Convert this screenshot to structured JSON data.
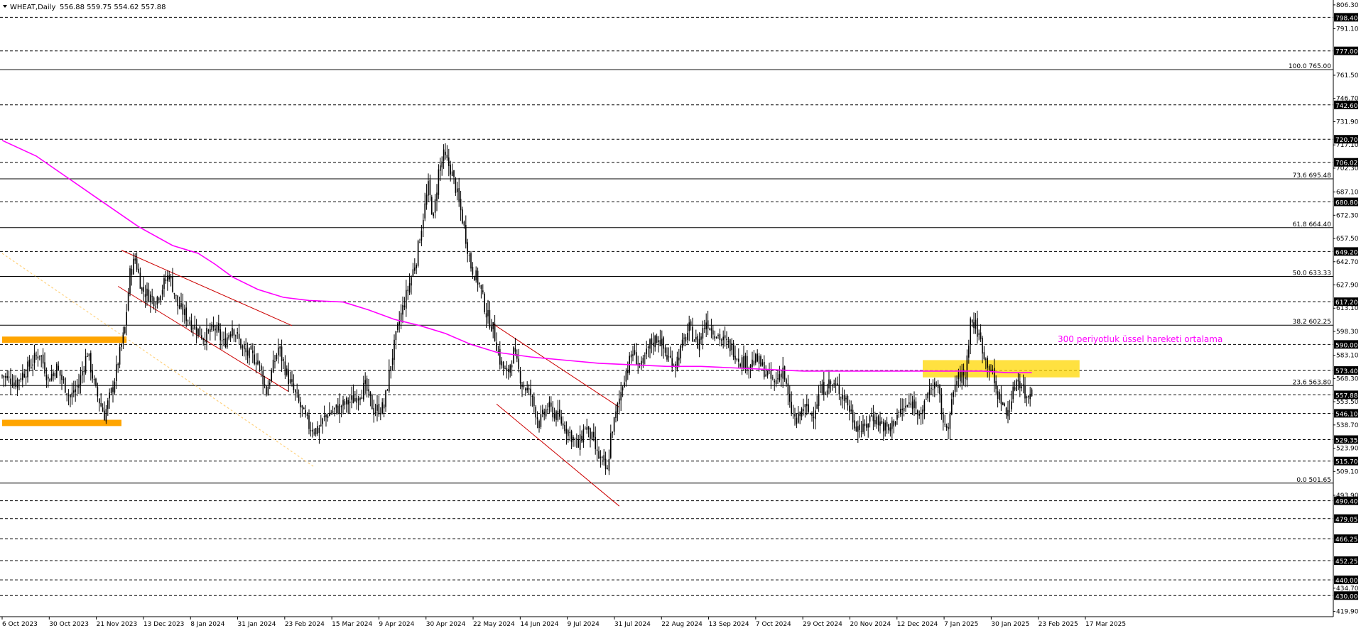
{
  "symbol_header": {
    "symbol": "WHEAT,Daily",
    "ohlc": "556.88 559.75 554.62 557.88"
  },
  "annotation_text": "300 periyotluk üssel hareketi ortalama",
  "colors": {
    "background": "#ffffff",
    "candle": "#000000",
    "ema": "#ff00ff",
    "zone": "#ffa500",
    "zone_highlight": "#ffd700",
    "channel": "#cc0000",
    "dotted_trend": "#ffd27f",
    "label_bg": "#000000",
    "label_text": "#ffffff",
    "annotation": "#ff00ff"
  },
  "chart_data": {
    "type": "candlestick",
    "symbol": "WHEAT",
    "timeframe": "Daily",
    "y_range": [
      417,
      806.25
    ],
    "price_axis_ticks": [
      "806.30",
      "791.10",
      "761.50",
      "746.70",
      "731.90",
      "717.10",
      "702.30",
      "687.10",
      "672.30",
      "657.50",
      "642.70",
      "627.90",
      "613.10",
      "598.30",
      "583.10",
      "568.30",
      "553.50",
      "538.70",
      "523.90",
      "509.10",
      "493.90",
      "434.70",
      "419.90"
    ],
    "date_axis_ticks": [
      "6 Oct 2023",
      "30 Oct 2023",
      "21 Nov 2023",
      "13 Dec 2023",
      "8 Jan 2024",
      "31 Jan 2024",
      "23 Feb 2024",
      "15 Mar 2024",
      "9 Apr 2024",
      "30 Apr 2024",
      "22 May 2024",
      "14 Jun 2024",
      "9 Jul 2024",
      "31 Jul 2024",
      "22 Aug 2024",
      "13 Sep 2024",
      "7 Oct 2024",
      "29 Oct 2024",
      "20 Nov 2024",
      "12 Dec 2024",
      "7 Jan 2025",
      "30 Jan 2025",
      "23 Feb 2025",
      "17 Mar 2025"
    ],
    "horizontal_levels": [
      "798.40",
      "777.00",
      "742.60",
      "720.70",
      "706.02",
      "680.80",
      "649.20",
      "617.20",
      "590.00",
      "573.40",
      "557.88",
      "546.10",
      "529.35",
      "515.70",
      "490.40",
      "479.05",
      "466.25",
      "452.25",
      "440.00",
      "430.00"
    ],
    "fibonacci_levels": [
      {
        "label": "100.0 765.00",
        "price": 765.0
      },
      {
        "label": "73.6 695.48",
        "price": 695.48
      },
      {
        "label": "61.8 664.40",
        "price": 664.4
      },
      {
        "label": "50.0 633.33",
        "price": 633.33
      },
      {
        "label": "38.2 602.25",
        "price": 602.25
      },
      {
        "label": "23.6 563.80",
        "price": 563.8
      },
      {
        "label": "0.0 501.65",
        "price": 501.65
      }
    ],
    "close_path": [
      [
        0,
        570
      ],
      [
        8,
        566
      ],
      [
        15,
        575
      ],
      [
        22,
        585
      ],
      [
        27,
        568
      ],
      [
        32,
        575
      ],
      [
        40,
        556
      ],
      [
        45,
        565
      ],
      [
        50,
        585
      ],
      [
        55,
        560
      ],
      [
        60,
        545
      ],
      [
        65,
        563
      ],
      [
        72,
        600
      ],
      [
        75,
        635
      ],
      [
        78,
        645
      ],
      [
        82,
        625
      ],
      [
        90,
        618
      ],
      [
        98,
        635
      ],
      [
        103,
        615
      ],
      [
        110,
        605
      ],
      [
        118,
        595
      ],
      [
        125,
        600
      ],
      [
        130,
        590
      ],
      [
        135,
        602
      ],
      [
        142,
        585
      ],
      [
        150,
        580
      ],
      [
        155,
        560
      ],
      [
        162,
        588
      ],
      [
        168,
        568
      ],
      [
        175,
        550
      ],
      [
        180,
        538
      ],
      [
        185,
        535
      ],
      [
        190,
        545
      ],
      [
        198,
        550
      ],
      [
        206,
        555
      ],
      [
        213,
        563
      ],
      [
        218,
        548
      ],
      [
        224,
        550
      ],
      [
        228,
        578
      ],
      [
        233,
        605
      ],
      [
        238,
        625
      ],
      [
        243,
        645
      ],
      [
        247,
        672
      ],
      [
        250,
        690
      ],
      [
        253,
        670
      ],
      [
        256,
        700
      ],
      [
        259,
        710
      ],
      [
        263,
        702
      ],
      [
        266,
        690
      ],
      [
        270,
        670
      ],
      [
        275,
        640
      ],
      [
        280,
        628
      ],
      [
        284,
        610
      ],
      [
        288,
        600
      ],
      [
        292,
        580
      ],
      [
        296,
        570
      ],
      [
        300,
        585
      ],
      [
        305,
        565
      ],
      [
        310,
        558
      ],
      [
        315,
        540
      ],
      [
        320,
        550
      ],
      [
        325,
        545
      ],
      [
        332,
        535
      ],
      [
        338,
        525
      ],
      [
        342,
        538
      ],
      [
        346,
        530
      ],
      [
        349,
        520
      ],
      [
        352,
        515
      ],
      [
        355,
        508
      ],
      [
        357,
        532
      ],
      [
        360,
        545
      ],
      [
        365,
        570
      ],
      [
        370,
        585
      ],
      [
        375,
        575
      ],
      [
        380,
        590
      ],
      [
        385,
        595
      ],
      [
        390,
        582
      ],
      [
        395,
        578
      ],
      [
        400,
        592
      ],
      [
        403,
        600
      ],
      [
        408,
        590
      ],
      [
        413,
        605
      ],
      [
        418,
        598
      ],
      [
        423,
        592
      ],
      [
        428,
        588
      ],
      [
        433,
        580
      ],
      [
        438,
        578
      ],
      [
        443,
        580
      ],
      [
        448,
        572
      ],
      [
        453,
        565
      ],
      [
        458,
        575
      ],
      [
        462,
        550
      ],
      [
        466,
        540
      ],
      [
        470,
        550
      ],
      [
        475,
        545
      ],
      [
        480,
        560
      ],
      [
        485,
        565
      ],
      [
        490,
        562
      ],
      [
        495,
        555
      ],
      [
        500,
        540
      ],
      [
        505,
        535
      ],
      [
        510,
        545
      ],
      [
        515,
        540
      ],
      [
        520,
        535
      ],
      [
        525,
        545
      ],
      [
        530,
        550
      ],
      [
        535,
        553
      ],
      [
        540,
        545
      ],
      [
        543,
        560
      ],
      [
        547,
        565
      ],
      [
        550,
        555
      ],
      [
        553,
        535
      ],
      [
        556,
        545
      ],
      [
        559,
        565
      ],
      [
        562,
        570
      ],
      [
        565,
        570
      ],
      [
        568,
        605
      ],
      [
        571,
        602
      ],
      [
        574,
        592
      ],
      [
        577,
        580
      ],
      [
        580,
        575
      ],
      [
        583,
        560
      ],
      [
        586,
        555
      ],
      [
        589,
        545
      ],
      [
        592,
        555
      ],
      [
        595,
        568
      ],
      [
        598,
        565
      ],
      [
        601,
        555
      ],
      [
        604,
        563
      ]
    ],
    "ema_path": [
      [
        0,
        720
      ],
      [
        20,
        710
      ],
      [
        40,
        695
      ],
      [
        60,
        680
      ],
      [
        80,
        665
      ],
      [
        100,
        653
      ],
      [
        115,
        648
      ],
      [
        125,
        641
      ],
      [
        135,
        633
      ],
      [
        150,
        625
      ],
      [
        165,
        620
      ],
      [
        180,
        618
      ],
      [
        200,
        617
      ],
      [
        215,
        612
      ],
      [
        230,
        606
      ],
      [
        245,
        602
      ],
      [
        260,
        597
      ],
      [
        275,
        590
      ],
      [
        290,
        585
      ],
      [
        310,
        582
      ],
      [
        330,
        580
      ],
      [
        350,
        578
      ],
      [
        370,
        577
      ],
      [
        390,
        576
      ],
      [
        410,
        576
      ],
      [
        430,
        575
      ],
      [
        450,
        574
      ],
      [
        470,
        573
      ],
      [
        490,
        573
      ],
      [
        510,
        573
      ],
      [
        530,
        573
      ],
      [
        545,
        573
      ],
      [
        560,
        573
      ],
      [
        575,
        573
      ],
      [
        590,
        572
      ],
      [
        604,
        572
      ]
    ],
    "zones": [
      {
        "type": "band",
        "x_start": 0,
        "x_end": 73,
        "y_low": 591,
        "y_high": 595
      },
      {
        "type": "band",
        "x_start": 0,
        "x_end": 70,
        "y_low": 538,
        "y_high": 542
      },
      {
        "type": "box",
        "x_start": 540,
        "x_end": 632,
        "y_low": 569,
        "y_high": 580
      }
    ],
    "channels": [
      [
        [
          70,
          650
        ],
        [
          170,
          602
        ]
      ],
      [
        [
          68,
          627
        ],
        [
          168,
          560
        ]
      ],
      [
        [
          288,
          603
        ],
        [
          362,
          550
        ]
      ],
      [
        [
          290,
          552
        ],
        [
          362,
          487
        ]
      ]
    ],
    "dotted_trend": [
      [
        0,
        648
      ],
      [
        183,
        512
      ]
    ]
  }
}
